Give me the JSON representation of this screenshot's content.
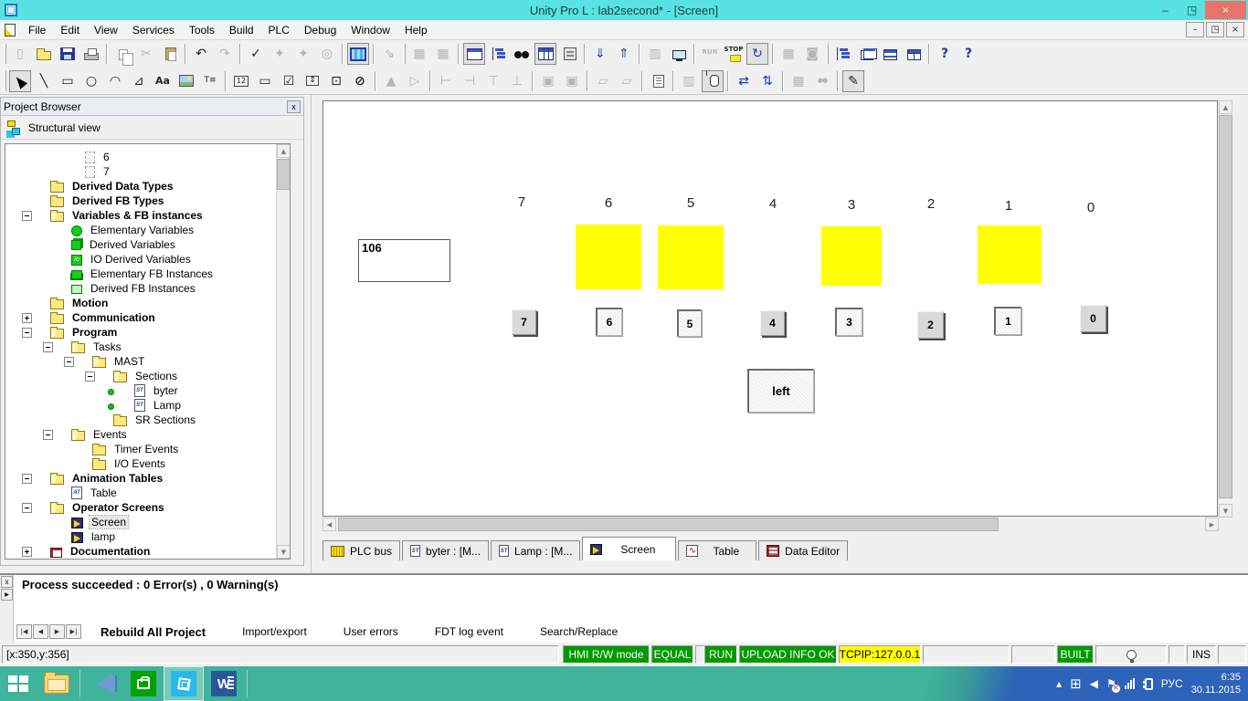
{
  "window": {
    "title": "Unity Pro L : lab2second* - [Screen]",
    "controls": {
      "min": "–",
      "restore": "◳",
      "close": "×"
    }
  },
  "menu": {
    "items": [
      "File",
      "Edit",
      "View",
      "Services",
      "Tools",
      "Build",
      "PLC",
      "Debug",
      "Window",
      "Help"
    ]
  },
  "icons": {
    "st": "ST",
    "at": "AT",
    "io": "io",
    "aa": "Aa",
    "te": "T≡",
    "counter": "12",
    "run": "RUN",
    "stop": "STOP",
    "help": "?",
    "sine": "∿",
    "close_small": "x",
    "scroll": {
      "up": "▲",
      "down": "▼",
      "left": "◀",
      "right": "▶"
    },
    "chevron_up": "▴",
    "win_logo": "⊞",
    "tray_speaker": "◀",
    "flag": "⚑",
    "err": "×"
  },
  "toolbars": {
    "row1": [
      {
        "n": "new-icon",
        "g": "▯"
      },
      {
        "n": "open-folder-icon",
        "g": ""
      },
      {
        "n": "save-icon",
        "g": ""
      },
      {
        "n": "print-icon",
        "g": ""
      },
      {
        "n": "copy-icon",
        "g": ""
      },
      {
        "n": "cut-icon",
        "g": "✂"
      },
      {
        "n": "paste-icon",
        "g": ""
      },
      {
        "n": "undo-icon",
        "g": "↶"
      },
      {
        "n": "redo-icon",
        "g": "↷"
      },
      {
        "n": "validate-icon",
        "g": "✓"
      },
      {
        "n": "analyze-wrench-icon",
        "g": "✦"
      },
      {
        "n": "project-wrench-icon",
        "g": "✦"
      },
      {
        "n": "zoom-project-icon",
        "g": "◎"
      },
      {
        "n": "hmi-grid-icon",
        "g": ""
      },
      {
        "n": "import-file-icon",
        "g": "⇘"
      },
      {
        "n": "pattern-insert-icon",
        "g": "▦"
      },
      {
        "n": "pattern-insert2-icon",
        "g": "▦"
      },
      {
        "n": "project-browser-icon",
        "g": ""
      },
      {
        "n": "structural-view-icon",
        "g": ""
      },
      {
        "n": "search-binoculars-icon",
        "g": ""
      },
      {
        "n": "data-editor-table-icon",
        "g": ""
      },
      {
        "n": "library-browser-icon",
        "g": ""
      },
      {
        "n": "download-project-icon",
        "g": "⇓"
      },
      {
        "n": "upload-project-icon",
        "g": "⇑"
      },
      {
        "n": "plc-rack-icon",
        "g": "▥"
      },
      {
        "n": "simulator-screen-icon",
        "g": ""
      },
      {
        "n": "run-icon",
        "g": "RUN"
      },
      {
        "n": "stop-icon",
        "g": "STOP"
      },
      {
        "n": "connect-refresh-icon",
        "g": "↻"
      },
      {
        "n": "module-config-icon",
        "g": "▦"
      },
      {
        "n": "operator-access-icon",
        "g": "◙"
      },
      {
        "n": "hierarchy-view-icon",
        "g": ""
      },
      {
        "n": "cascade-windows-icon",
        "g": ""
      },
      {
        "n": "tile-horizontal-icon",
        "g": ""
      },
      {
        "n": "tile-vertical-icon",
        "g": ""
      },
      {
        "n": "help-icon",
        "g": "?"
      },
      {
        "n": "context-help-icon",
        "g": "?"
      }
    ],
    "row2": [
      {
        "n": "select-cursor-icon",
        "g": ""
      },
      {
        "n": "line-tool-icon",
        "g": "╲"
      },
      {
        "n": "rectangle-tool-icon",
        "g": "▭"
      },
      {
        "n": "ellipse-tool-icon",
        "g": "○"
      },
      {
        "n": "arc-tool-icon",
        "g": "◠"
      },
      {
        "n": "polygon-tool-icon",
        "g": "⊿"
      },
      {
        "n": "text-tool-icon",
        "g": "Aa"
      },
      {
        "n": "image-tool-icon",
        "g": ""
      },
      {
        "n": "text-field-icon",
        "g": "T≡"
      },
      {
        "n": "counter-display-icon",
        "g": "12"
      },
      {
        "n": "button-tool-icon",
        "g": "▭"
      },
      {
        "n": "checkbox-tool-icon",
        "g": "☑"
      },
      {
        "n": "spinbox-tool-icon",
        "g": "⇕"
      },
      {
        "n": "slider-tool-icon",
        "g": "⊡"
      },
      {
        "n": "forbidden-icon",
        "g": "⊘"
      },
      {
        "n": "flip-horizontal-icon",
        "g": "▲"
      },
      {
        "n": "flip-vertical-icon",
        "g": "▷"
      },
      {
        "n": "align-left-icon",
        "g": "⊢"
      },
      {
        "n": "align-right-icon",
        "g": "⊣"
      },
      {
        "n": "align-top-icon",
        "g": "⊤"
      },
      {
        "n": "align-bottom-icon",
        "g": "⊥"
      },
      {
        "n": "group-icon",
        "g": "▣"
      },
      {
        "n": "ungroup-icon",
        "g": "▣"
      },
      {
        "n": "bring-front-icon",
        "g": "▱"
      },
      {
        "n": "send-back-icon",
        "g": "▱"
      },
      {
        "n": "properties-sheet-icon",
        "g": ""
      },
      {
        "n": "rack-preview-icon",
        "g": "▥"
      },
      {
        "n": "mouse-interaction-icon",
        "g": ""
      },
      {
        "n": "tab-order-icon",
        "g": "⇄"
      },
      {
        "n": "link-order-icon",
        "g": "⇅"
      },
      {
        "n": "module-grid-icon",
        "g": "▦"
      },
      {
        "n": "screen-search-icon",
        "g": "●●"
      },
      {
        "n": "screen-edit-icon",
        "g": "✎"
      }
    ]
  },
  "project_browser": {
    "title": "Project Browser",
    "close_glyph": "x",
    "view_label": "Structural view",
    "tree": [
      {
        "label": "6"
      },
      {
        "label": "7"
      },
      {
        "label": "Derived Data Types"
      },
      {
        "label": "Derived FB Types"
      },
      {
        "label": "Variables & FB instances"
      },
      {
        "label": "Elementary Variables"
      },
      {
        "label": "Derived Variables"
      },
      {
        "label": "IO Derived Variables"
      },
      {
        "label": "Elementary FB Instances"
      },
      {
        "label": "Derived FB Instances"
      },
      {
        "label": "Motion"
      },
      {
        "label": "Communication"
      },
      {
        "label": "Program"
      },
      {
        "label": "Tasks"
      },
      {
        "label": "MAST"
      },
      {
        "label": "Sections"
      },
      {
        "label": "byter"
      },
      {
        "label": "Lamp"
      },
      {
        "label": "SR Sections"
      },
      {
        "label": "Events"
      },
      {
        "label": "Timer Events"
      },
      {
        "label": "I/O Events"
      },
      {
        "label": "Animation Tables"
      },
      {
        "label": "Table"
      },
      {
        "label": "Operator Screens"
      },
      {
        "label": "Screen"
      },
      {
        "label": "lamp"
      },
      {
        "label": "Documentation"
      }
    ]
  },
  "screen": {
    "value_display": "106",
    "bit_labels": [
      "7",
      "6",
      "5",
      "4",
      "3",
      "2",
      "1",
      "0"
    ],
    "lamps_on_bits": [
      "6",
      "5",
      "3",
      "1"
    ],
    "lamp_on_color": "#ffff00",
    "buttons": [
      {
        "label": "7",
        "lit": false
      },
      {
        "label": "6",
        "lit": true
      },
      {
        "label": "5",
        "lit": true
      },
      {
        "label": "4",
        "lit": false
      },
      {
        "label": "3",
        "lit": true
      },
      {
        "label": "2",
        "lit": false
      },
      {
        "label": "1",
        "lit": true
      },
      {
        "label": "0",
        "lit": false
      }
    ],
    "left_button_label": "left"
  },
  "editor_tabs": [
    {
      "label": "PLC bus"
    },
    {
      "label": "byter : [M..."
    },
    {
      "label": "Lamp : [M..."
    },
    {
      "label": "Screen",
      "active": true
    },
    {
      "label": "Table"
    },
    {
      "label": "Data Editor"
    }
  ],
  "output": {
    "message": "Process succeeded  : 0 Error(s) , 0 Warning(s)",
    "nav": [
      "|◀",
      "◀",
      "▶",
      "▶|"
    ],
    "tabs": [
      "Rebuild All Project",
      "Import/export",
      "User errors",
      "FDT log event",
      "Search/Replace"
    ]
  },
  "status_bar": {
    "coords": "[x:350,y:356]",
    "hmi": "HMI R/W mode",
    "equal": "EQUAL",
    "run": "RUN",
    "upload": "UPLOAD INFO OK",
    "tcpip": "TCPIP:127.0.0.1",
    "built": "BUILT",
    "ins": "INS",
    "badge_green": "#009a00",
    "badge_yellow": "#ffff00"
  },
  "taskbar": {
    "lang": "РУС",
    "time": "6:35",
    "date": "30.11.2015",
    "teal": "#3fb39b",
    "blue": "#2d63b8"
  },
  "colors": {
    "titlebar": "#58e2e2",
    "close_button": "#e8756a",
    "lamp": "#ffff00"
  }
}
